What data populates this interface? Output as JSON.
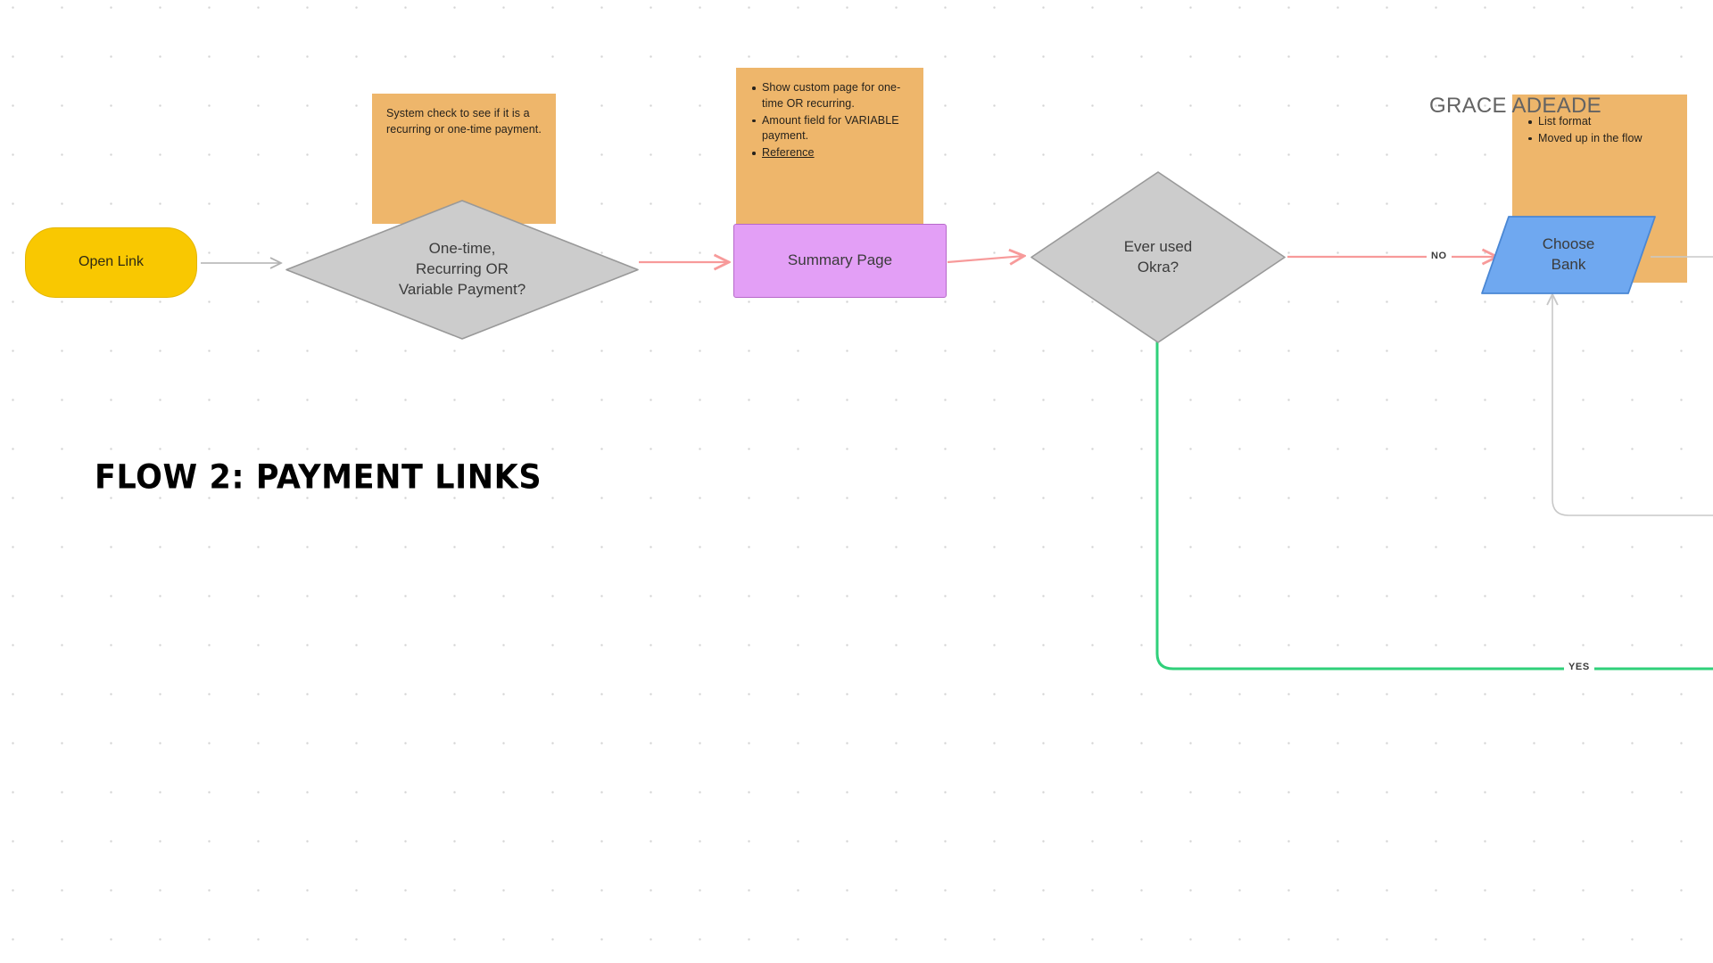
{
  "board": {
    "title": "FLOW 2: PAYMENT LINKS",
    "owner_label": "GRACE ADEADE",
    "background": "#ffffff",
    "dot_color": "#d4d4d4"
  },
  "nodes": [
    {
      "id": "open-link",
      "label": "Open Link",
      "shape": "rounded-rect",
      "fill": "#f9c801",
      "stroke": "#e3b500"
    },
    {
      "id": "payment-type-decision",
      "label": "One-time,\nRecurring OR\nVariable Payment?",
      "shape": "diamond",
      "fill": "#cccccc",
      "stroke": "#999999"
    },
    {
      "id": "summary-page",
      "label": "Summary Page",
      "shape": "rect",
      "fill": "#e39ff6",
      "stroke": "#b668c9"
    },
    {
      "id": "ever-used-okra-decision",
      "label": "Ever used\nOkra?",
      "shape": "diamond",
      "fill": "#cccccc",
      "stroke": "#999999"
    },
    {
      "id": "choose-bank",
      "label": "Choose\nBank",
      "shape": "parallelogram",
      "fill": "#6fa8f0",
      "stroke": "#4a87d4"
    }
  ],
  "sticky_notes": [
    {
      "id": "note-system-check",
      "fill": "#eeb66b",
      "type": "paragraph",
      "text": "System check to see if it is a recurring or one-time payment."
    },
    {
      "id": "note-summary-page",
      "fill": "#eeb66b",
      "type": "bullets",
      "bullets": [
        {
          "text": "Show custom page for one-time OR recurring.",
          "underlined": false
        },
        {
          "text": "Amount field for VARIABLE payment.",
          "underlined": false
        },
        {
          "text": "Reference",
          "underlined": true
        }
      ]
    },
    {
      "id": "note-choose-bank",
      "fill": "#eeb66b",
      "type": "bullets",
      "bullets": [
        {
          "text": "List format",
          "underlined": false
        },
        {
          "text": "Moved up in the flow",
          "underlined": false
        }
      ]
    }
  ],
  "edges": [
    {
      "id": "edge-open-to-decision",
      "label": "",
      "color": "#b0b0b0"
    },
    {
      "id": "edge-decision-to-summary",
      "label": "",
      "color": "#f79a9a"
    },
    {
      "id": "edge-summary-to-okra",
      "label": "",
      "color": "#f79a9a"
    },
    {
      "id": "edge-okra-no-to-bank",
      "label": "NO",
      "color": "#f79a9a"
    },
    {
      "id": "edge-okra-yes",
      "label": "YES",
      "color": "#2fd07a"
    },
    {
      "id": "edge-return-to-bank",
      "label": "",
      "color": "#c8c8c8"
    },
    {
      "id": "edge-bank-out-right",
      "label": "",
      "color": "#c8c8c8"
    }
  ]
}
